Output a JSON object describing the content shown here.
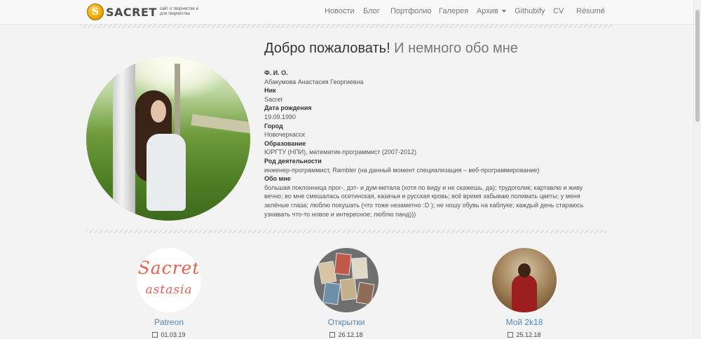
{
  "logo": {
    "letter": "S",
    "text": "SACRET",
    "tagline": "сайт о творчестве и для творчества"
  },
  "nav": {
    "items": [
      "Новости",
      "Блог",
      "Портфолио",
      "Галерея",
      "Архив",
      "Githubify",
      "CV",
      "Résumé"
    ]
  },
  "about": {
    "title_main": "Добро пожаловать!",
    "title_sub": " И немного обо мне",
    "fields": [
      {
        "label": "Ф. И. О.",
        "value": "Абакумова Анастасия Георгиевна"
      },
      {
        "label": "Ник",
        "value": "Sacret"
      },
      {
        "label": "Дата рождения",
        "value": "19.09.1990"
      },
      {
        "label": "Город",
        "value": "Новочеркасск"
      },
      {
        "label": "Образование",
        "value": "ЮРГТУ (НПИ), математик-программист (2007-2012)"
      },
      {
        "label": "Род деятельности",
        "value": "инженер-программист, Rambler (на данный момент специализация – веб-программирование)"
      },
      {
        "label": "Обо мне",
        "value": "большая поклонница прог-, дэт- и дум-метала (хотя по виду и не скажешь, да); трудоголик; картавлю и живу вечно; во мне смешалась осетинская, казачья и русская кровь; всё время забываю поливать цветы; у меня зелёные глаза; люблю покушать (что тоже незаметно :D ); не ношу обувь на каблуке; каждый день стараюсь узнавать что-то новое и интересное; люблю панд)))"
      }
    ]
  },
  "cards": [
    {
      "title": "Patreon",
      "date": "01.03.19",
      "thumb_text_1": "Sacret",
      "thumb_text_2": "astasia"
    },
    {
      "title": "Открытки",
      "date": "26.12.18"
    },
    {
      "title": "Мой 2k18",
      "date": "25.12.18"
    }
  ],
  "colors": {
    "link": "#4f86c6",
    "accent_logo": "#f0a400"
  }
}
